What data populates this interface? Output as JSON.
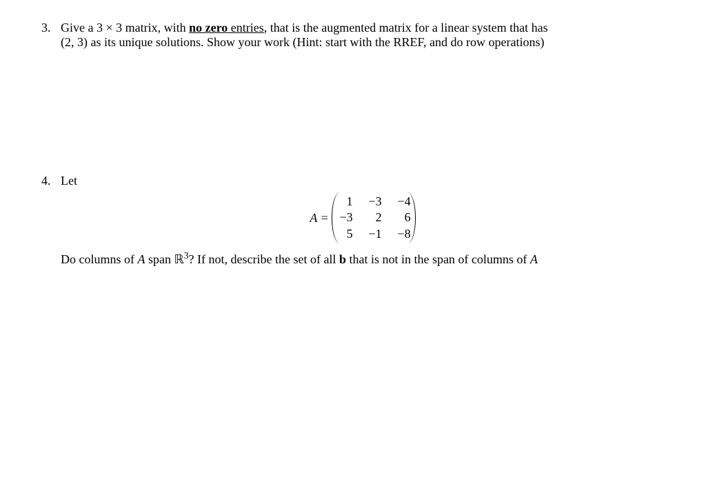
{
  "problems": {
    "p3": {
      "number": "3.",
      "line1_pre": "Give a 3 × 3 matrix, with ",
      "no_zero_text": "no zero",
      "line1_mid": " entries",
      "line1_post": ", that is the augmented matrix for a linear system that has",
      "line2": "(2, 3) as its unique solutions. Show your work (Hint: start with the RREF, and do row operations)"
    },
    "p4": {
      "number": "4.",
      "let_text": "Let",
      "matrix_lhs": "A =",
      "matrix": {
        "r1c1": "1",
        "r1c2": "−3",
        "r1c3": "−4",
        "r2c1": "−3",
        "r2c2": "2",
        "r2c3": "6",
        "r3c1": "5",
        "r3c2": "−1",
        "r3c3": "−8"
      },
      "q_pre": "Do columns of ",
      "q_A1": "A",
      "q_span": " span ",
      "q_R": "ℝ",
      "q_R_sup": "3",
      "q_mid": "? If not, describe the set of all ",
      "q_b": "b",
      "q_post1": " that is not in the span of columns of ",
      "q_A2": "A"
    }
  }
}
